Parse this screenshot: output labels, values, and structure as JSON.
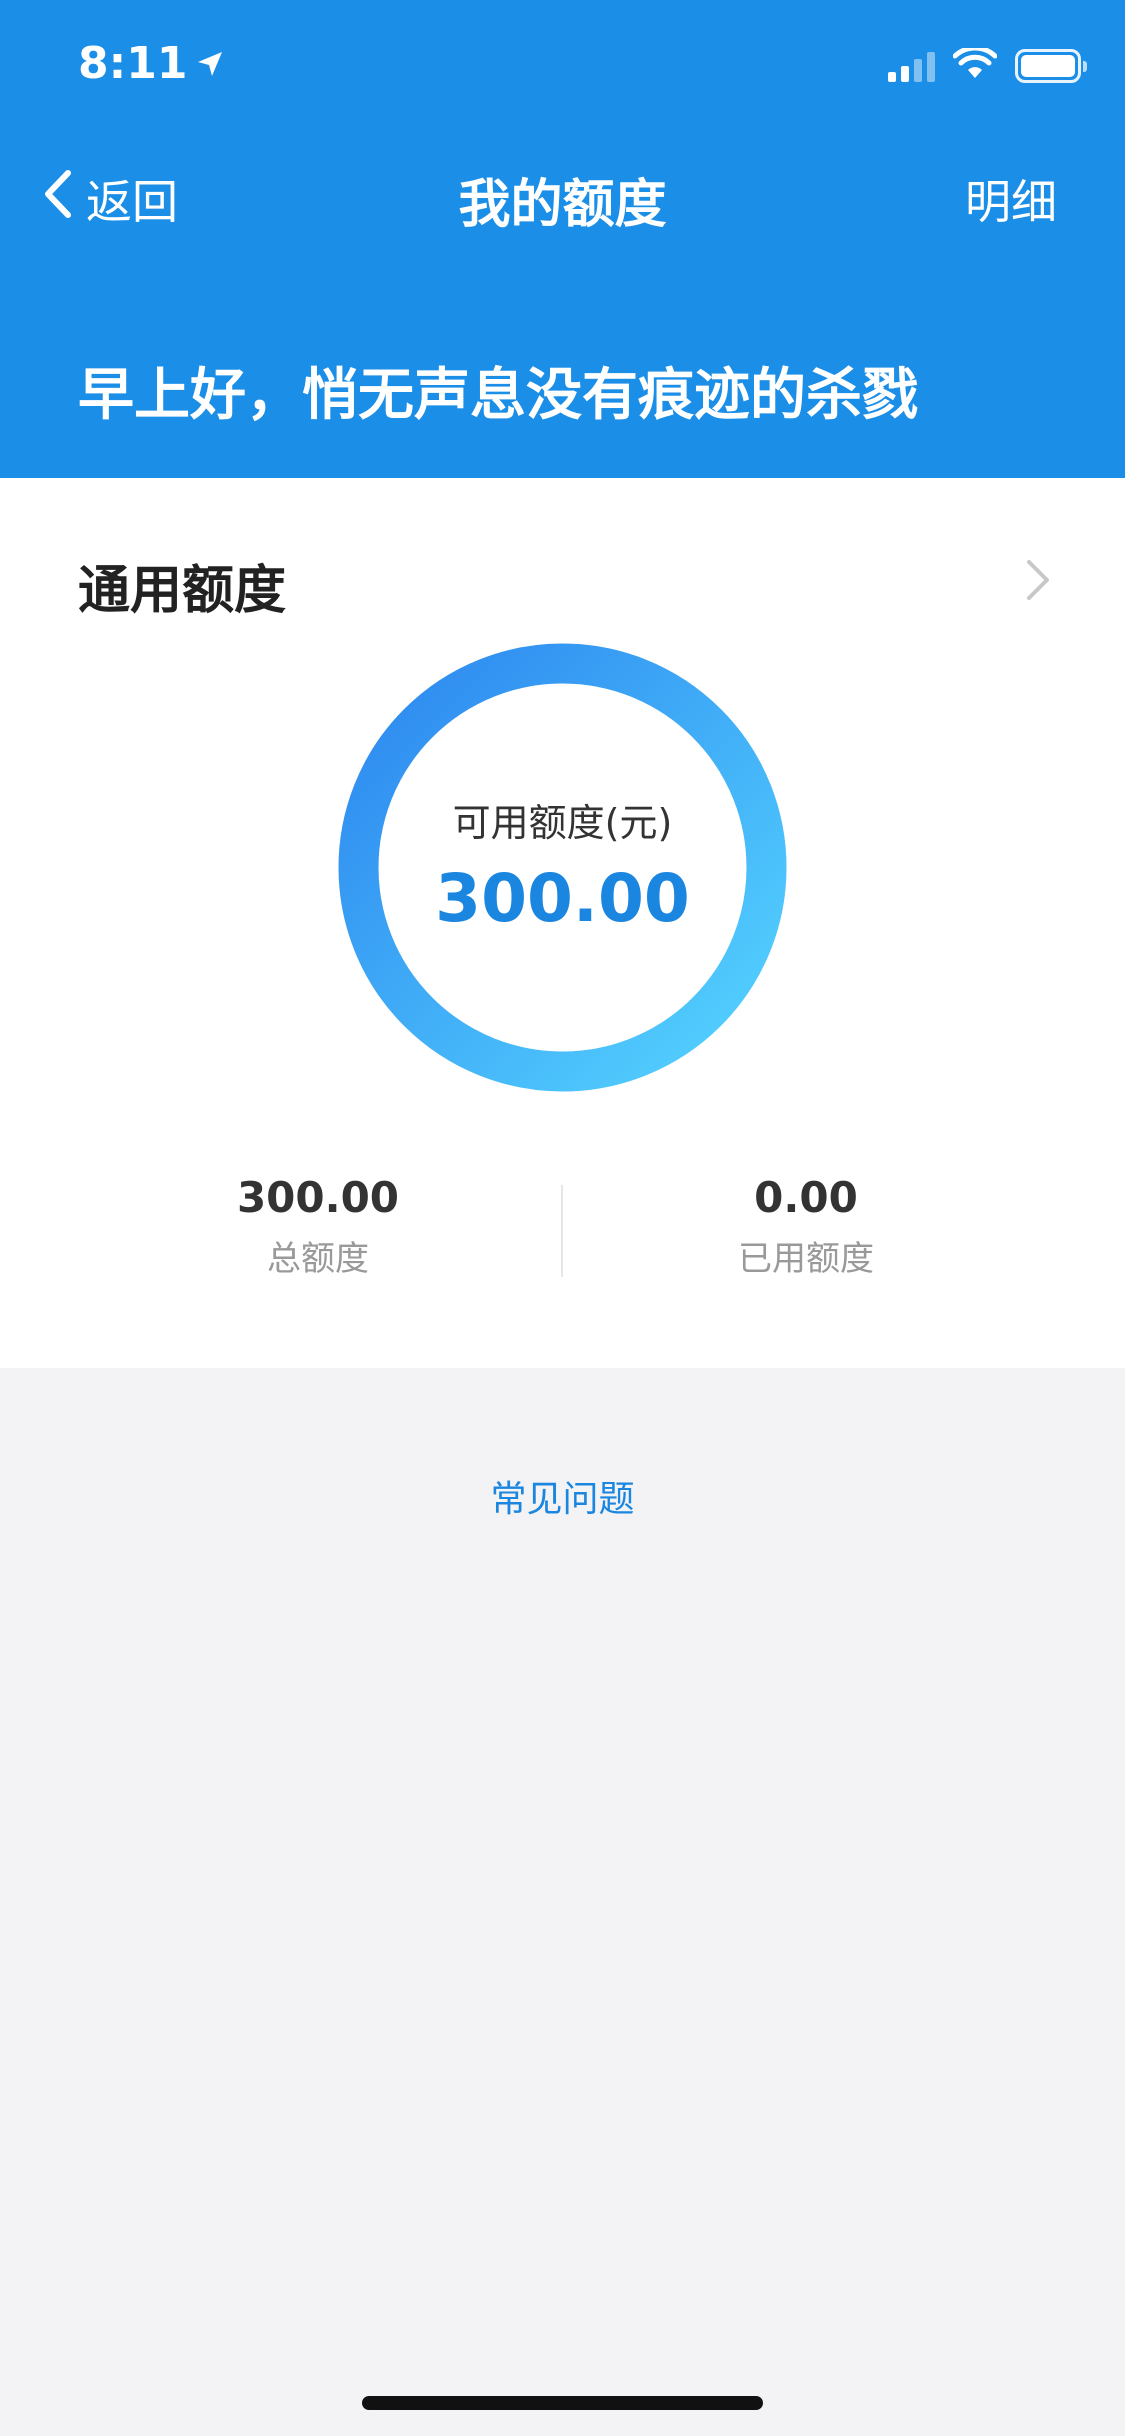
{
  "status_bar": {
    "time": "8:11"
  },
  "nav": {
    "back_label": "返回",
    "title": "我的额度",
    "detail_label": "明细"
  },
  "greeting": "早上好，悄无声息没有痕迹的杀戮",
  "card": {
    "title": "通用额度",
    "available_label": "可用额度(元)",
    "available_value": "300.00",
    "available_fraction": 1.0,
    "stats": {
      "total_value": "300.00",
      "total_label": "总额度",
      "used_value": "0.00",
      "used_label": "已用额度"
    }
  },
  "faq_label": "常见问题",
  "colors": {
    "header_bg": "#1b8ee7",
    "accent": "#1b86e0",
    "ring_start": "#4fd0ff",
    "ring_end": "#2e8bf0",
    "page_bg": "#f3f3f6"
  },
  "icons": {
    "back": "chevron-left-icon",
    "chevron": "chevron-right-icon",
    "location": "location-arrow-icon",
    "signal": "signal-icon",
    "wifi": "wifi-icon",
    "battery": "battery-icon"
  }
}
